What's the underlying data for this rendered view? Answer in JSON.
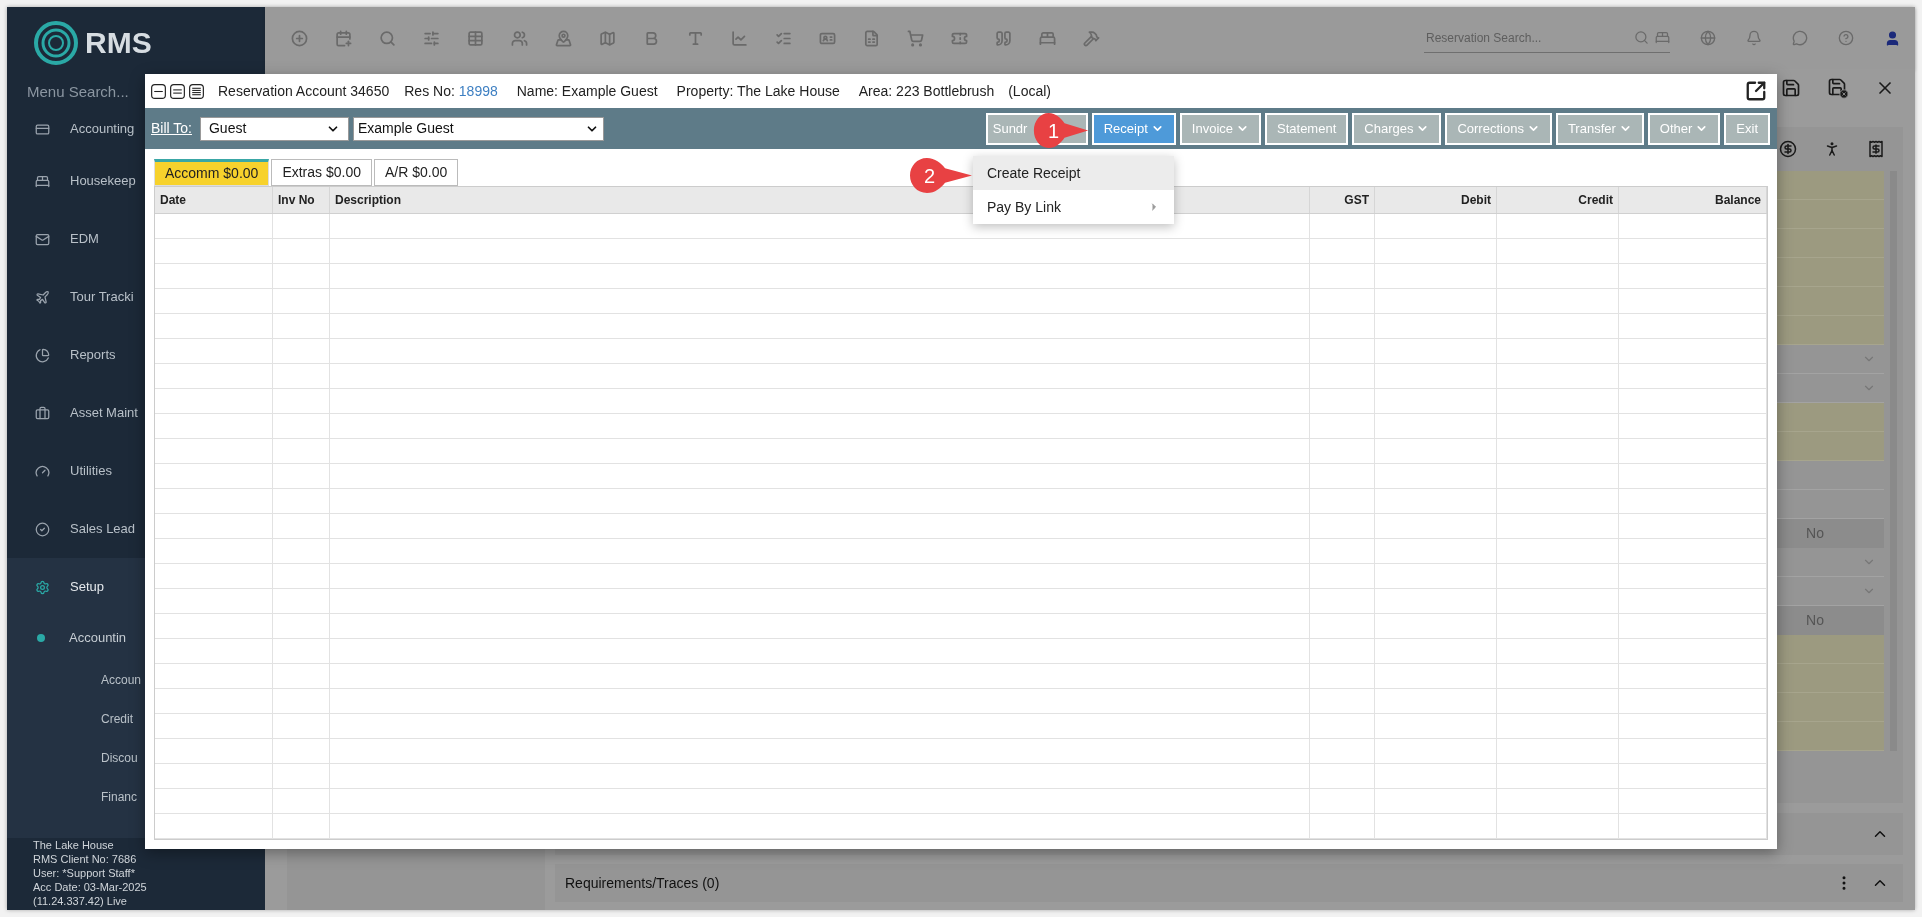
{
  "sidebar": {
    "logo": "RMS",
    "menu_search": {
      "placeholder": "Menu Search..."
    },
    "items": [
      {
        "label": "Accounting",
        "selected": false
      },
      {
        "label": "Housekeep",
        "selected": false
      },
      {
        "label": "EDM",
        "selected": false
      },
      {
        "label": "Tour Tracki",
        "selected": false
      },
      {
        "label": "Reports",
        "selected": false
      },
      {
        "label": "Asset Maint",
        "selected": false
      },
      {
        "label": "Utilities",
        "selected": false
      },
      {
        "label": "Sales Lead",
        "selected": false
      },
      {
        "label": "Setup",
        "selected": true,
        "children": [
          {
            "label": "Accountin",
            "children": [
              {
                "label": "Accoun"
              },
              {
                "label": "Credit"
              },
              {
                "label": "Discou"
              },
              {
                "label": "Financ"
              }
            ]
          }
        ]
      }
    ],
    "footer": [
      "The Lake House",
      "RMS Client No: 7686",
      "User: *Support Staff*",
      "Acc Date: 03-Mar-2025",
      "(11.24.337.42) Live"
    ]
  },
  "top_bar": {
    "search": {
      "placeholder": "Reservation Search..."
    }
  },
  "modal": {
    "title": "Reservation Account 34650",
    "res_no": {
      "label": "Res No:",
      "value": "18998"
    },
    "name": "Name: Example Guest",
    "property": "Property: The Lake House",
    "area": "Area: 223 Bottlebrush",
    "scope": "(Local)",
    "bill_to": {
      "label": "Bill To:",
      "type": "Guest",
      "account": "Example Guest"
    },
    "buttons": [
      {
        "label": "Sundr",
        "dropdown": false,
        "selected": false
      },
      {
        "label": "Receipt",
        "dropdown": true,
        "selected": true
      },
      {
        "label": "Invoice",
        "dropdown": true,
        "selected": false
      },
      {
        "label": "Statement",
        "dropdown": false,
        "selected": false
      },
      {
        "label": "Charges",
        "dropdown": true,
        "selected": false
      },
      {
        "label": "Corrections",
        "dropdown": true,
        "selected": false
      },
      {
        "label": "Transfer",
        "dropdown": true,
        "selected": false
      },
      {
        "label": "Other",
        "dropdown": true,
        "selected": false
      },
      {
        "label": "Exit",
        "dropdown": false,
        "selected": false
      }
    ],
    "menu": {
      "items": [
        {
          "label": "Create Receipt",
          "highlighted": true,
          "submenu": false
        },
        {
          "label": "Pay By Link",
          "highlighted": false,
          "submenu": true
        }
      ]
    },
    "callouts": [
      "1",
      "2"
    ],
    "tabs": [
      {
        "label": "Accomm $0.00",
        "selected": true
      },
      {
        "label": "Extras $0.00",
        "selected": false
      },
      {
        "label": "A/R $0.00",
        "selected": false
      }
    ],
    "table": {
      "columns": [
        "Date",
        "Inv No",
        "Description",
        "GST",
        "Debit",
        "Credit",
        "Balance"
      ]
    }
  },
  "background": {
    "rows": [
      {
        "kind": "yellow"
      },
      {
        "kind": "yellow"
      },
      {
        "kind": "yellow"
      },
      {
        "kind": "yellow"
      },
      {
        "kind": "yellow"
      },
      {
        "kind": "yellow"
      },
      {
        "kind": "chevron"
      },
      {
        "kind": "chevron"
      },
      {
        "kind": "yellow"
      },
      {
        "kind": "yellow"
      },
      {
        "kind": "blank"
      },
      {
        "kind": "blank"
      },
      {
        "kind": "value",
        "text": "No"
      },
      {
        "kind": "chevron"
      },
      {
        "kind": "chevron"
      },
      {
        "kind": "value",
        "text": "No"
      },
      {
        "kind": "yellow"
      },
      {
        "kind": "yellow"
      },
      {
        "kind": "yellow"
      },
      {
        "kind": "yellow"
      }
    ],
    "requirements": "Requirements/Traces (0)"
  }
}
